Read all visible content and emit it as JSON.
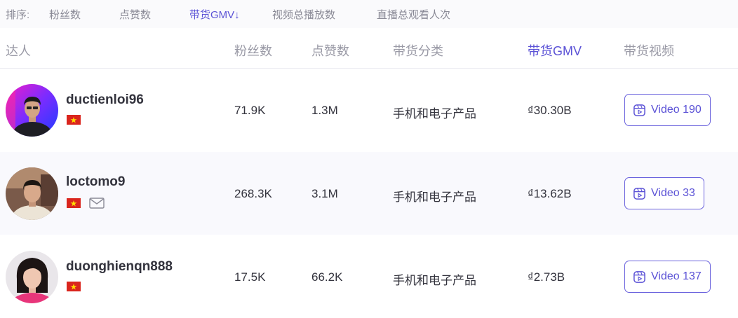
{
  "sort_bar": {
    "label": "排序:",
    "options": [
      "粉丝数",
      "点赞数",
      "带货GMV↓",
      "视频总播放数",
      "直播总观看人次"
    ],
    "active_index": 2
  },
  "table": {
    "columns": [
      "达人",
      "粉丝数",
      "点赞数",
      "带货分类",
      "带货GMV",
      "带货视频"
    ],
    "active_column_index": 4,
    "rows": [
      {
        "username": "ductienloi96",
        "flag": "vietnam-flag",
        "has_email": false,
        "followers": "71.9K",
        "likes": "1.3M",
        "category": "手机和电子产品",
        "gmv": "₫30.30B",
        "video_button": "Video 190"
      },
      {
        "username": "loctomo9",
        "flag": "vietnam-flag",
        "has_email": true,
        "followers": "268.3K",
        "likes": "3.1M",
        "category": "手机和电子产品",
        "gmv": "₫13.62B",
        "video_button": "Video 33"
      },
      {
        "username": "duonghienqn888",
        "flag": "vietnam-flag",
        "has_email": false,
        "followers": "17.5K",
        "likes": "66.2K",
        "category": "手机和电子产品",
        "gmv": "₫2.73B",
        "video_button": "Video 137"
      }
    ]
  },
  "colors": {
    "accent": "#5b52d6",
    "muted_text": "#9a9aa6",
    "alt_row": "#f9f9fd",
    "flag_red": "#da251d",
    "flag_star": "#ffdd00"
  }
}
